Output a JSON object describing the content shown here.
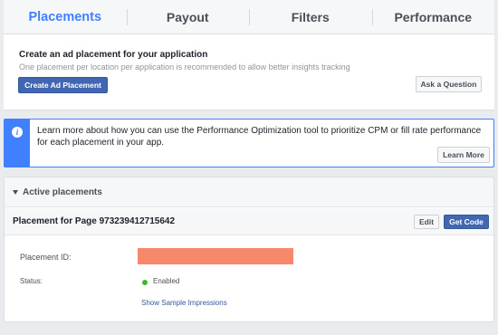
{
  "tabs": [
    {
      "label": "Placements",
      "active": true
    },
    {
      "label": "Payout"
    },
    {
      "label": "Filters"
    },
    {
      "label": "Performance"
    }
  ],
  "create": {
    "title": "Create an ad placement for your application",
    "subtitle": "One placement per location per application is recommended to allow better insights tracking",
    "create_button": "Create Ad Placement",
    "ask_button": "Ask a Question"
  },
  "info": {
    "icon": "info-icon",
    "text": "Learn more about how you can use the Performance Optimization tool to prioritize CPM or fill rate performance for each placement in your app.",
    "learn_more": "Learn More"
  },
  "active": {
    "heading": "Active placements",
    "placement_title": "Placement for Page 973239412715642",
    "edit": "Edit",
    "get_code": "Get Code",
    "id_label": "Placement ID:",
    "status_label": "Status:",
    "status_value": "Enabled",
    "sample_link": "Show Sample Impressions"
  },
  "colors": {
    "accent": "#4080ff",
    "primary_button": "#4267b2",
    "redaction": "#f6896a",
    "status_enabled": "#42b72a"
  }
}
